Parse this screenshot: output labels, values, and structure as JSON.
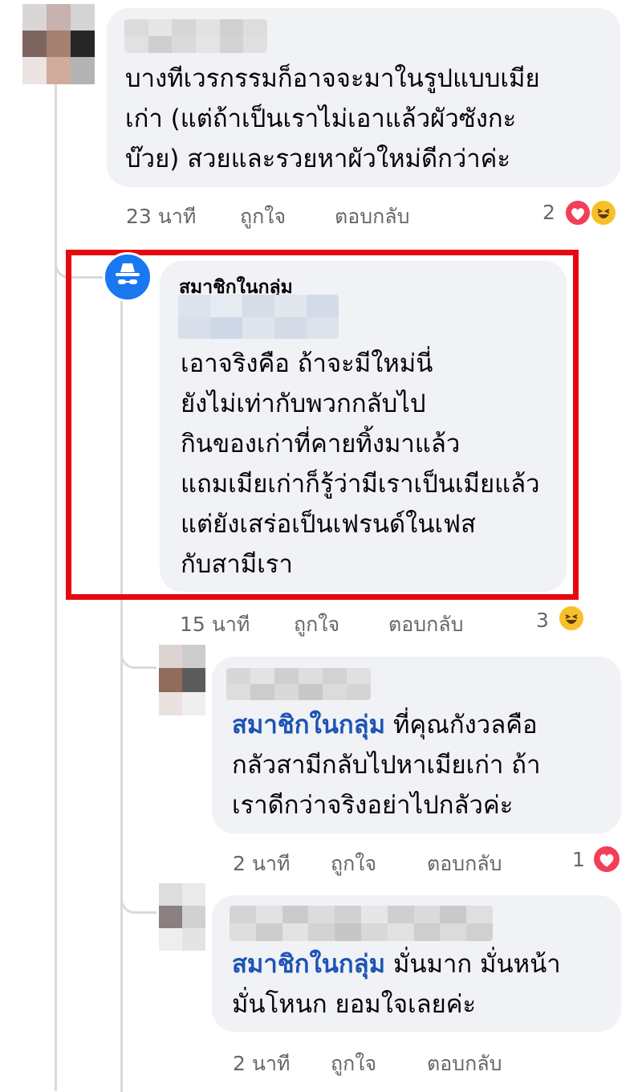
{
  "comments": [
    {
      "text_lines": [
        "บางทีเวรกรรมก็อาจจะมาในรูปแบบเมีย",
        "เก่า (แต่ถ้าเป็นเราไม่เอาแล้วผัวซังกะ",
        "บ๊วย) สวยและรวยหาผัวใหม่ดีกว่าค่ะ"
      ],
      "time": "23 นาที",
      "like": "ถูกใจ",
      "reply": "ตอบกลับ",
      "reaction_count": "2",
      "reactions": [
        "heart",
        "haha"
      ]
    },
    {
      "author": "สมาชิกในกลุ่ม",
      "text_lines": [
        "เอาจริงคือ ถ้าจะมีใหม่นี่",
        "ยังไม่เท่ากับพวกกลับไป",
        "กินของเก่าที่คายทิ้งมาแล้ว",
        "แถมเมียเก่าก็รู้ว่ามีเราเป็นเมียแล้ว",
        "แต่ยังเสร่อเป็นเฟรนด์ในเฟส",
        "กับสามีเรา"
      ],
      "time": "15 นาที",
      "like": "ถูกใจ",
      "reply": "ตอบกลับ",
      "reaction_count": "3",
      "reactions": [
        "haha"
      ]
    },
    {
      "mention": "สมาชิกในกลุ่ม",
      "text_first": " ที่คุณกังวลคือ",
      "text_lines": [
        "กลัวสามีกลับไปหาเมียเก่า ถ้า",
        "เราดีกว่าจริงอย่าไปกลัวค่ะ"
      ],
      "time": "2 นาที",
      "like": "ถูกใจ",
      "reply": "ตอบกลับ",
      "reaction_count": "1",
      "reactions": [
        "heart"
      ]
    },
    {
      "mention": "สมาชิกในกลุ่ม",
      "text_first": " มั่นมาก มั่นหน้า",
      "text_lines": [
        "มั่นโหนก ยอมใจเลยค่ะ"
      ],
      "time": "2 นาที",
      "like": "ถูกใจ",
      "reply": "ตอบกลับ"
    }
  ],
  "colors": {
    "highlight_box": "#e8070f",
    "mention": "#1c53b5",
    "bubble": "#f0f2f5",
    "meta": "#65676b"
  },
  "icons": {
    "anonymous_avatar": "anonymous-member-icon",
    "heart_reaction": "heart-icon",
    "haha_reaction": "haha-icon"
  }
}
